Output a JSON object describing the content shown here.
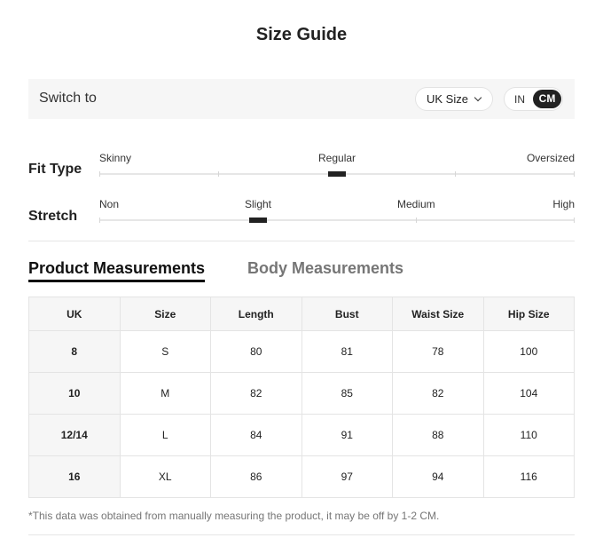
{
  "title": "Size Guide",
  "switch_bar": {
    "label": "Switch to",
    "size_system": "UK Size",
    "unit_options": [
      "IN",
      "CM"
    ],
    "selected_unit": "CM"
  },
  "fit_type": {
    "title": "Fit Type",
    "labels": [
      "Skinny",
      "Regular",
      "Oversized"
    ],
    "selected": "Regular"
  },
  "stretch": {
    "title": "Stretch",
    "labels": [
      "Non",
      "Slight",
      "Medium",
      "High"
    ],
    "selected": "Slight"
  },
  "tabs": [
    "Product Measurements",
    "Body Measurements"
  ],
  "active_tab": "Product Measurements",
  "table": {
    "headers": [
      "UK",
      "Size",
      "Length",
      "Bust",
      "Waist Size",
      "Hip Size"
    ],
    "rows": [
      [
        "8",
        "S",
        "80",
        "81",
        "78",
        "100"
      ],
      [
        "10",
        "M",
        "82",
        "85",
        "82",
        "104"
      ],
      [
        "12/14",
        "L",
        "84",
        "91",
        "88",
        "110"
      ],
      [
        "16",
        "XL",
        "86",
        "97",
        "94",
        "116"
      ]
    ]
  },
  "note": "*This data was obtained from manually measuring the product, it may be off by 1-2 CM."
}
